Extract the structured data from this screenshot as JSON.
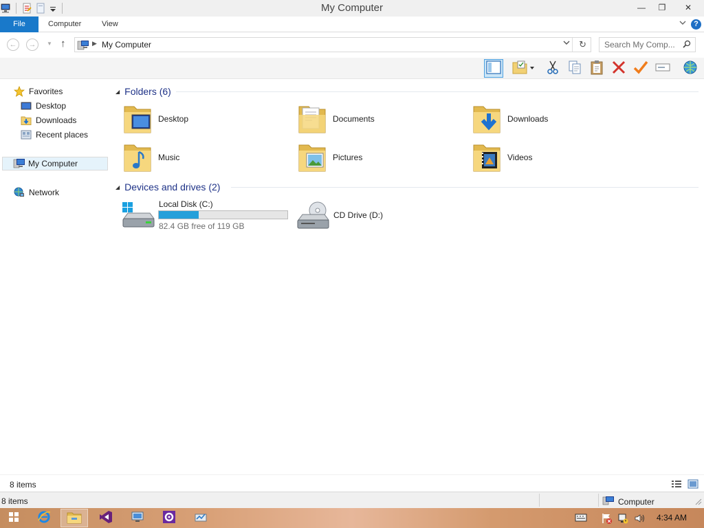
{
  "window": {
    "title": "My Computer"
  },
  "window_controls": {
    "minimize": "—",
    "restore": "❐",
    "close": "✕"
  },
  "ribbon": {
    "tabs": [
      {
        "label": "File",
        "active": true
      },
      {
        "label": "Computer"
      },
      {
        "label": "View"
      }
    ],
    "help": "?"
  },
  "navigation": {
    "back": "←",
    "forward": "→",
    "up": "↑",
    "breadcrumb": "My Computer",
    "search_placeholder": "Search My Comp..."
  },
  "toolbar": {
    "buttons": [
      "preview-pane",
      "folder-options",
      "cut",
      "copy",
      "paste",
      "delete",
      "check",
      "rename",
      "globe"
    ]
  },
  "navpane": {
    "favorites": "Favorites",
    "favorites_items": [
      "Desktop",
      "Downloads",
      "Recent places"
    ],
    "computer": "My Computer",
    "network": "Network"
  },
  "content": {
    "folders_header": "Folders (6)",
    "folders": [
      {
        "name": "Desktop",
        "icon": "desktop-folder"
      },
      {
        "name": "Documents",
        "icon": "documents-folder"
      },
      {
        "name": "Downloads",
        "icon": "downloads-folder"
      },
      {
        "name": "Music",
        "icon": "music-folder"
      },
      {
        "name": "Pictures",
        "icon": "pictures-folder"
      },
      {
        "name": "Videos",
        "icon": "videos-folder"
      }
    ],
    "drives_header": "Devices and drives (2)",
    "drives": [
      {
        "name": "Local Disk (C:)",
        "free_text": "82.4 GB free of 119 GB",
        "used_fraction": 0.31
      },
      {
        "name": "CD Drive (D:)"
      }
    ]
  },
  "details": {
    "item_count": "8 items"
  },
  "status": {
    "item_count": "8 items",
    "location": "Computer"
  },
  "taskbar": {
    "apps": [
      "start",
      "internet-explorer",
      "file-explorer",
      "visual-studio",
      "remote-desktop",
      "settings",
      "network-tool"
    ],
    "clock": "4:34 AM"
  },
  "colors": {
    "accent": "#1979ca",
    "progress": "#26a0da",
    "folder": "#f2d174",
    "header_text": "#1e3287"
  }
}
